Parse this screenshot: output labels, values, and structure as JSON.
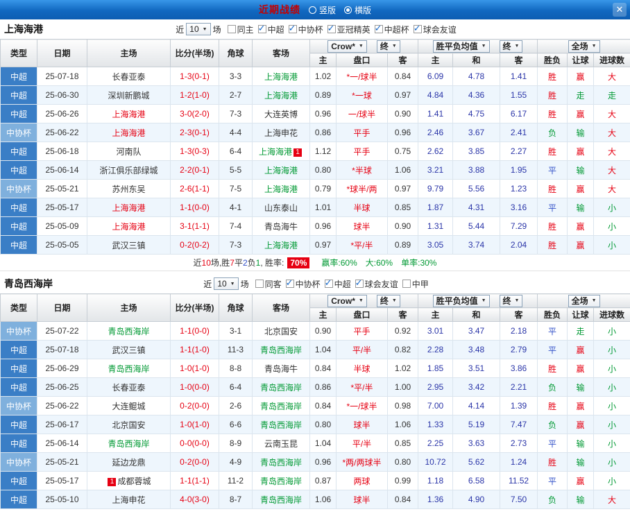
{
  "titlebar": {
    "title": "近期战绩",
    "options": [
      {
        "label": "竖版",
        "selected": false
      },
      {
        "label": "横版",
        "selected": true
      }
    ],
    "close_glyph": "✕"
  },
  "colors": {
    "accent_blue": "#1168c0",
    "win_red": "#e60012",
    "lose_green": "#009933",
    "draw_blue": "#3150c8",
    "csl_cell_blue": "#3a7ec6",
    "cup_cell_blue": "#7fb0dd",
    "odds_blue": "#2a35a8"
  },
  "table_header": {
    "type": "类型",
    "date": "日期",
    "home": "主场",
    "score": "比分(半场)",
    "corner": "角球",
    "away": "客场",
    "book_select": "Crow*",
    "final_select": "终",
    "avg_select": "胜平负均值",
    "final2_select": "终",
    "scope_select": "全场",
    "sub": [
      "主",
      "盘口",
      "客",
      "主",
      "和",
      "客",
      "胜负",
      "让球",
      "进球数"
    ]
  },
  "sections": [
    {
      "team": "上海海港",
      "filter": {
        "prefix": "近",
        "count": "10",
        "suffix": "场",
        "checks": [
          {
            "label": "同主",
            "checked": false
          },
          {
            "label": "中超",
            "checked": true
          },
          {
            "label": "中协杯",
            "checked": true
          },
          {
            "label": "亚冠精英",
            "checked": true
          },
          {
            "label": "中超杯",
            "checked": true
          },
          {
            "label": "球会友谊",
            "checked": true
          }
        ]
      },
      "rows": [
        {
          "type": "中超",
          "tc": "csl",
          "date": "25-07-18",
          "home": "长春亚泰",
          "hc": "",
          "hb": "",
          "score": "1-3(0-1)",
          "corner": "3-3",
          "away": "上海海港",
          "ac": "fg",
          "ab": "",
          "ah": [
            "1.02",
            "*一/球半",
            "0.84"
          ],
          "odds": [
            "6.09",
            "4.78",
            "1.41"
          ],
          "res": [
            "胜",
            "赢",
            "大"
          ],
          "rc": [
            "r",
            "r",
            "r"
          ]
        },
        {
          "type": "中超",
          "tc": "csl",
          "date": "25-06-30",
          "home": "深圳新鹏城",
          "hc": "",
          "hb": "",
          "score": "1-2(1-0)",
          "corner": "2-7",
          "away": "上海海港",
          "ac": "fg",
          "ab": "",
          "ah": [
            "0.89",
            "*一球",
            "0.97"
          ],
          "odds": [
            "4.84",
            "4.36",
            "1.55"
          ],
          "res": [
            "胜",
            "走",
            "走"
          ],
          "rc": [
            "r",
            "g",
            "g"
          ]
        },
        {
          "type": "中超",
          "tc": "csl",
          "date": "25-06-26",
          "home": "上海海港",
          "hc": "fr",
          "hb": "",
          "score": "3-0(2-0)",
          "corner": "7-3",
          "away": "大连英博",
          "ac": "",
          "ab": "",
          "ah": [
            "0.96",
            "一/球半",
            "0.90"
          ],
          "odds": [
            "1.41",
            "4.75",
            "6.17"
          ],
          "res": [
            "胜",
            "赢",
            "大"
          ],
          "rc": [
            "r",
            "r",
            "r"
          ]
        },
        {
          "type": "中协杯",
          "tc": "cup",
          "date": "25-06-22",
          "home": "上海海港",
          "hc": "fr",
          "hb": "",
          "score": "2-3(0-1)",
          "corner": "4-4",
          "away": "上海申花",
          "ac": "",
          "ab": "",
          "ah": [
            "0.86",
            "平手",
            "0.96"
          ],
          "odds": [
            "2.46",
            "3.67",
            "2.41"
          ],
          "res": [
            "负",
            "输",
            "大"
          ],
          "rc": [
            "g",
            "g",
            "r"
          ]
        },
        {
          "type": "中超",
          "tc": "csl",
          "date": "25-06-18",
          "home": "河南队",
          "hc": "",
          "hb": "",
          "score": "1-3(0-3)",
          "corner": "6-4",
          "away": "上海海港",
          "ac": "fg",
          "ab": "1",
          "ah": [
            "1.12",
            "平手",
            "0.75"
          ],
          "odds": [
            "2.62",
            "3.85",
            "2.27"
          ],
          "res": [
            "胜",
            "赢",
            "大"
          ],
          "rc": [
            "r",
            "r",
            "r"
          ]
        },
        {
          "type": "中超",
          "tc": "csl",
          "date": "25-06-14",
          "home": "浙江俱乐部绿城",
          "hc": "",
          "hb": "",
          "score": "2-2(0-1)",
          "corner": "5-5",
          "away": "上海海港",
          "ac": "fg",
          "ab": "",
          "ah": [
            "0.80",
            "*半球",
            "1.06"
          ],
          "odds": [
            "3.21",
            "3.88",
            "1.95"
          ],
          "res": [
            "平",
            "输",
            "大"
          ],
          "rc": [
            "b",
            "g",
            "r"
          ]
        },
        {
          "type": "中协杯",
          "tc": "cup",
          "date": "25-05-21",
          "home": "苏州东吴",
          "hc": "",
          "hb": "",
          "score": "2-6(1-1)",
          "corner": "7-5",
          "away": "上海海港",
          "ac": "fg",
          "ab": "",
          "ah": [
            "0.79",
            "*球半/两",
            "0.97"
          ],
          "odds": [
            "9.79",
            "5.56",
            "1.23"
          ],
          "res": [
            "胜",
            "赢",
            "大"
          ],
          "rc": [
            "r",
            "r",
            "r"
          ]
        },
        {
          "type": "中超",
          "tc": "csl",
          "date": "25-05-17",
          "home": "上海海港",
          "hc": "fr",
          "hb": "",
          "score": "1-1(0-0)",
          "corner": "4-1",
          "away": "山东泰山",
          "ac": "",
          "ab": "",
          "ah": [
            "1.01",
            "半球",
            "0.85"
          ],
          "odds": [
            "1.87",
            "4.31",
            "3.16"
          ],
          "res": [
            "平",
            "输",
            "小"
          ],
          "rc": [
            "b",
            "g",
            "g"
          ]
        },
        {
          "type": "中超",
          "tc": "csl",
          "date": "25-05-09",
          "home": "上海海港",
          "hc": "fr",
          "hb": "",
          "score": "3-1(1-1)",
          "corner": "7-4",
          "away": "青岛海牛",
          "ac": "",
          "ab": "",
          "ah": [
            "0.96",
            "球半",
            "0.90"
          ],
          "odds": [
            "1.31",
            "5.44",
            "7.29"
          ],
          "res": [
            "胜",
            "赢",
            "小"
          ],
          "rc": [
            "r",
            "r",
            "g"
          ]
        },
        {
          "type": "中超",
          "tc": "csl",
          "date": "25-05-05",
          "home": "武汉三镇",
          "hc": "",
          "hb": "",
          "score": "0-2(0-2)",
          "corner": "7-3",
          "away": "上海海港",
          "ac": "fg",
          "ab": "",
          "ah": [
            "0.97",
            "*平/半",
            "0.89"
          ],
          "odds": [
            "3.05",
            "3.74",
            "2.04"
          ],
          "res": [
            "胜",
            "赢",
            "小"
          ],
          "rc": [
            "r",
            "r",
            "g"
          ]
        }
      ],
      "summary": {
        "parts": [
          {
            "t": "近",
            "c": "k"
          },
          {
            "t": "10",
            "c": "r"
          },
          {
            "t": "场,胜",
            "c": "k"
          },
          {
            "t": "7",
            "c": "r"
          },
          {
            "t": "平",
            "c": "k"
          },
          {
            "t": "2",
            "c": "b"
          },
          {
            "t": "负",
            "c": "k"
          },
          {
            "t": "1",
            "c": "g"
          },
          {
            "t": ", 胜率:",
            "c": "k"
          }
        ],
        "rate_badge": "70%",
        "tail": [
          {
            "t": "赢率:60%",
            "c": "g"
          },
          {
            "t": "大:60%",
            "c": "g"
          },
          {
            "t": "单率:30%",
            "c": "g"
          }
        ]
      }
    },
    {
      "team": "青岛西海岸",
      "filter": {
        "prefix": "近",
        "count": "10",
        "suffix": "场",
        "checks": [
          {
            "label": "同客",
            "checked": false
          },
          {
            "label": "中协杯",
            "checked": true
          },
          {
            "label": "中超",
            "checked": true
          },
          {
            "label": "球会友谊",
            "checked": true
          },
          {
            "label": "中甲",
            "checked": false
          }
        ]
      },
      "rows": [
        {
          "type": "中协杯",
          "tc": "cup",
          "date": "25-07-22",
          "home": "青岛西海岸",
          "hc": "fg",
          "hb": "",
          "score": "1-1(0-0)",
          "corner": "3-1",
          "away": "北京国安",
          "ac": "",
          "ab": "",
          "ah": [
            "0.90",
            "平手",
            "0.92"
          ],
          "odds": [
            "3.01",
            "3.47",
            "2.18"
          ],
          "res": [
            "平",
            "走",
            "小"
          ],
          "rc": [
            "b",
            "g",
            "g"
          ]
        },
        {
          "type": "中超",
          "tc": "csl",
          "date": "25-07-18",
          "home": "武汉三镇",
          "hc": "",
          "hb": "",
          "score": "1-1(1-0)",
          "corner": "11-3",
          "away": "青岛西海岸",
          "ac": "fg",
          "ab": "",
          "ah": [
            "1.04",
            "平/半",
            "0.82"
          ],
          "odds": [
            "2.28",
            "3.48",
            "2.79"
          ],
          "res": [
            "平",
            "赢",
            "小"
          ],
          "rc": [
            "b",
            "r",
            "g"
          ]
        },
        {
          "type": "中超",
          "tc": "csl",
          "date": "25-06-29",
          "home": "青岛西海岸",
          "hc": "fg",
          "hb": "",
          "score": "1-0(1-0)",
          "corner": "8-8",
          "away": "青岛海牛",
          "ac": "",
          "ab": "",
          "ah": [
            "0.84",
            "半球",
            "1.02"
          ],
          "odds": [
            "1.85",
            "3.51",
            "3.86"
          ],
          "res": [
            "胜",
            "赢",
            "小"
          ],
          "rc": [
            "r",
            "r",
            "g"
          ]
        },
        {
          "type": "中超",
          "tc": "csl",
          "date": "25-06-25",
          "home": "长春亚泰",
          "hc": "",
          "hb": "",
          "score": "1-0(0-0)",
          "corner": "6-4",
          "away": "青岛西海岸",
          "ac": "fg",
          "ab": "",
          "ah": [
            "0.86",
            "*平/半",
            "1.00"
          ],
          "odds": [
            "2.95",
            "3.42",
            "2.21"
          ],
          "res": [
            "负",
            "输",
            "小"
          ],
          "rc": [
            "g",
            "g",
            "g"
          ]
        },
        {
          "type": "中协杯",
          "tc": "cup",
          "date": "25-06-22",
          "home": "大连鲲城",
          "hc": "",
          "hb": "",
          "score": "0-2(0-0)",
          "corner": "2-6",
          "away": "青岛西海岸",
          "ac": "fg",
          "ab": "",
          "ah": [
            "0.84",
            "*一/球半",
            "0.98"
          ],
          "odds": [
            "7.00",
            "4.14",
            "1.39"
          ],
          "res": [
            "胜",
            "赢",
            "小"
          ],
          "rc": [
            "r",
            "r",
            "g"
          ]
        },
        {
          "type": "中超",
          "tc": "csl",
          "date": "25-06-17",
          "home": "北京国安",
          "hc": "",
          "hb": "",
          "score": "1-0(1-0)",
          "corner": "6-6",
          "away": "青岛西海岸",
          "ac": "fg",
          "ab": "",
          "ah": [
            "0.80",
            "球半",
            "1.06"
          ],
          "odds": [
            "1.33",
            "5.19",
            "7.47"
          ],
          "res": [
            "负",
            "赢",
            "小"
          ],
          "rc": [
            "g",
            "r",
            "g"
          ]
        },
        {
          "type": "中超",
          "tc": "csl",
          "date": "25-06-14",
          "home": "青岛西海岸",
          "hc": "fg",
          "hb": "",
          "score": "0-0(0-0)",
          "corner": "8-9",
          "away": "云南玉昆",
          "ac": "",
          "ab": "",
          "ah": [
            "1.04",
            "平/半",
            "0.85"
          ],
          "odds": [
            "2.25",
            "3.63",
            "2.73"
          ],
          "res": [
            "平",
            "输",
            "小"
          ],
          "rc": [
            "b",
            "g",
            "g"
          ]
        },
        {
          "type": "中协杯",
          "tc": "cup",
          "date": "25-05-21",
          "home": "延边龙鼎",
          "hc": "",
          "hb": "",
          "score": "0-2(0-0)",
          "corner": "4-9",
          "away": "青岛西海岸",
          "ac": "fg",
          "ab": "",
          "ah": [
            "0.96",
            "*两/两球半",
            "0.80"
          ],
          "odds": [
            "10.72",
            "5.62",
            "1.24"
          ],
          "res": [
            "胜",
            "输",
            "小"
          ],
          "rc": [
            "r",
            "g",
            "g"
          ]
        },
        {
          "type": "中超",
          "tc": "csl",
          "date": "25-05-17",
          "home": "成都蓉城",
          "hc": "",
          "hb": "1",
          "score": "1-1(1-1)",
          "corner": "11-2",
          "away": "青岛西海岸",
          "ac": "fg",
          "ab": "",
          "ah": [
            "0.87",
            "两球",
            "0.99"
          ],
          "odds": [
            "1.18",
            "6.58",
            "11.52"
          ],
          "res": [
            "平",
            "赢",
            "小"
          ],
          "rc": [
            "b",
            "r",
            "g"
          ]
        },
        {
          "type": "中超",
          "tc": "csl",
          "date": "25-05-10",
          "home": "上海申花",
          "hc": "",
          "hb": "",
          "score": "4-0(3-0)",
          "corner": "8-7",
          "away": "青岛西海岸",
          "ac": "fg",
          "ab": "",
          "ah": [
            "1.06",
            "球半",
            "0.84"
          ],
          "odds": [
            "1.36",
            "4.90",
            "7.50"
          ],
          "res": [
            "负",
            "输",
            "大"
          ],
          "rc": [
            "g",
            "g",
            "r"
          ]
        }
      ]
    }
  ]
}
